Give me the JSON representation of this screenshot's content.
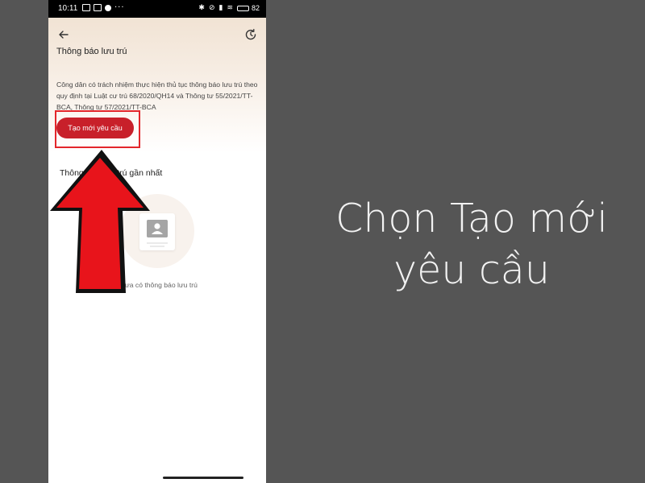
{
  "status_bar": {
    "time": "10:11",
    "battery_text": "82",
    "battery_level": 0.82
  },
  "header": {
    "title": "Thông báo lưu trú"
  },
  "description": {
    "text": "Công dân có trách nhiệm thực hiện thủ tục thông báo lưu trú theo quy định tại Luật cư trú 68/2020/QH14 và Thông tư 55/2021/TT-BCA, Thông tư 57/2021/TT-BCA"
  },
  "actions": {
    "create_label": "Tạo mới yêu cầu"
  },
  "recent": {
    "title": "Thông báo lưu trú gần nhất",
    "empty_text": "Chưa có thông báo lưu trú"
  },
  "caption": {
    "line1": "Chọn Tạo mới",
    "line2": "yêu cầu"
  },
  "colors": {
    "accent": "#c8202a",
    "highlight": "#e3262b",
    "arrow": "#e8141b",
    "background": "#555555"
  },
  "icons": {
    "back": "arrow-left-icon",
    "history": "history-icon",
    "empty_state": "document-avatar-icon"
  }
}
